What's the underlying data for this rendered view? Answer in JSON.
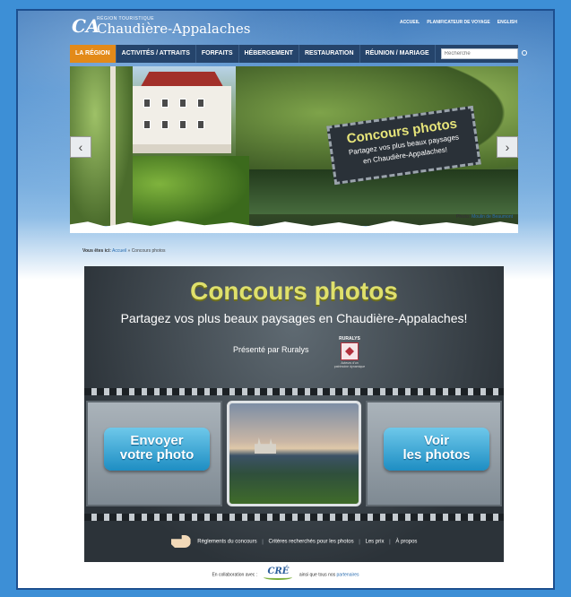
{
  "header": {
    "logo_small": "RÉGION TOURISTIQUE",
    "logo_big": "Chaudière-Appalaches",
    "links": [
      "ACCUEIL",
      "PLANIFICATEUR DE VOYAGE",
      "ENGLISH"
    ]
  },
  "nav": {
    "items": [
      "LA RÉGION",
      "ACTIVITÉS / ATTRAITS",
      "FORFAITS",
      "HÉBERGEMENT",
      "RESTAURATION",
      "RÉUNION / MARIAGE"
    ],
    "search_placeholder": "Recherche"
  },
  "banner": {
    "tag_title": "Concours photos",
    "tag_sub1": "Partagez vos plus beaux paysages",
    "tag_sub2": "en Chaudière-Appalaches!",
    "credit_label": "Photo:",
    "credit_link": "Moulin de Beaumont"
  },
  "breadcrumb": {
    "label": "Vous êtes ici:",
    "home": "Accueil",
    "sep": "»",
    "current": "Concours photos"
  },
  "contest": {
    "title": "Concours photos",
    "subtitle": "Partagez vos plus beaux paysages en Chaudière-Appalaches!",
    "presented": "Présenté par Ruralys",
    "sponsor_name": "RURALYS",
    "sponsor_tag": "Acteurs d'un patrimoine dynamique",
    "btn_send_1": "Envoyer",
    "btn_send_2": "votre photo",
    "btn_view_1": "Voir",
    "btn_view_2": "les photos",
    "footer_links": [
      "Règlements du concours",
      "Critères recherchés pour les photos",
      "Les prix",
      "À propos"
    ]
  },
  "collab": {
    "prefix": "En collaboration avec :",
    "logo": "CRÉ",
    "suffix": "ainsi que tous nos",
    "link": "partenaires"
  },
  "colors": {
    "nav_bg": "#25446b",
    "nav_active": "#e38a19",
    "title_yellow": "#dfe06c",
    "button_blue": "#1e8ec3"
  }
}
